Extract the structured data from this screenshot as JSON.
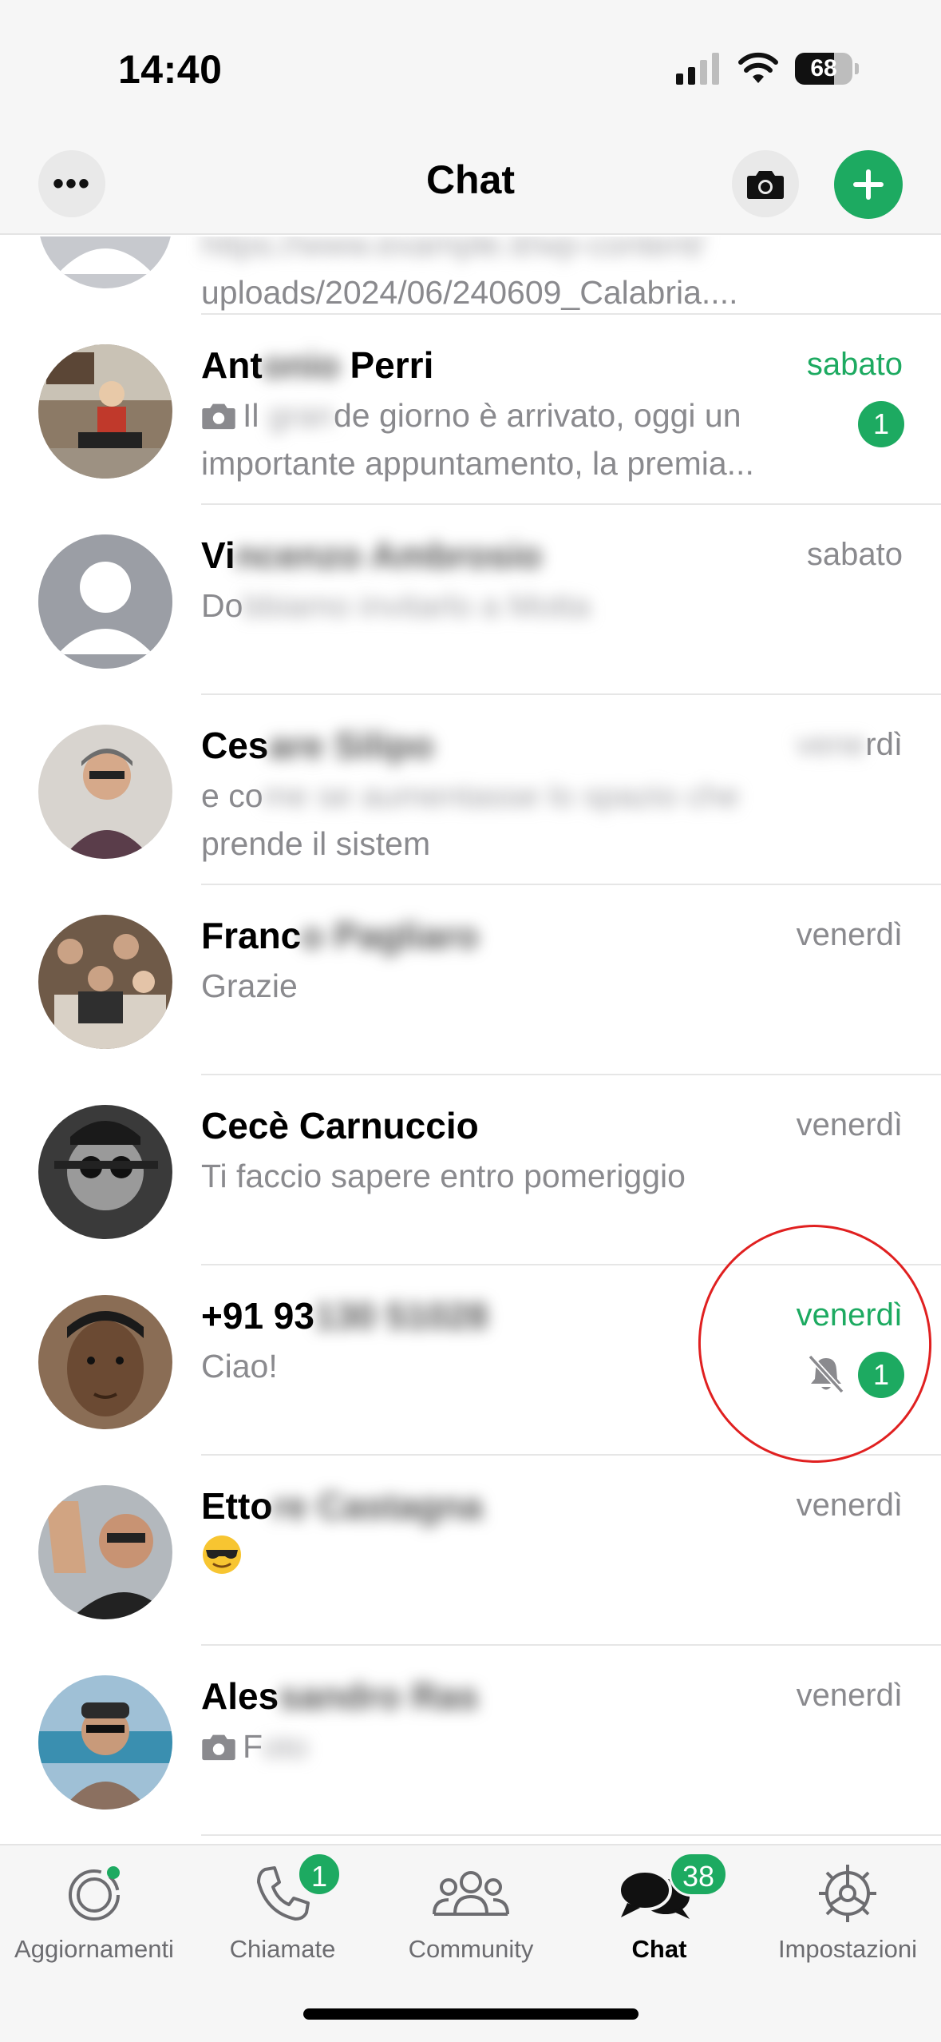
{
  "status_bar": {
    "time": "14:40",
    "battery": "68",
    "battery_level_pct": 68
  },
  "header": {
    "more_label": "•••",
    "title": "Chat"
  },
  "colors": {
    "accent": "#1daa61",
    "secondary_text": "#8a8a8e",
    "annotation": "#e02020"
  },
  "chats": [
    {
      "name": "",
      "date": "",
      "preview": "uploads/2024/06/240609_Calabria....",
      "preview_top": "",
      "avatar": "default"
    },
    {
      "name_visible": "Ant",
      "name_hidden": "onio",
      "name_end": " Perri",
      "date": "sabato",
      "date_green": true,
      "preview_icon": "camera-icon",
      "preview_visible": "Il ",
      "preview_hidden": "gran",
      "preview": "de giorno è arrivato, oggi un importante appuntamento, la premia...",
      "unread": "1",
      "avatar": "photo"
    },
    {
      "name_visible": "Vi",
      "name_hidden": "ncenzo Ambrosio",
      "date": "sabato",
      "preview_visible": "Do",
      "preview_hidden": "bbiamo invitarlo a Motta",
      "avatar": "default"
    },
    {
      "name_visible": "Ces",
      "name_hidden": "are Silipo",
      "date_hidden": "vene",
      "date": "rdì",
      "preview_visible": "e co",
      "preview_hidden": "me se aumentasse lo spazio che",
      "preview": "prende il sistem",
      "avatar": "photo"
    },
    {
      "name_visible": "Franc",
      "name_hidden": "o Pagliaro",
      "date": "venerdì",
      "preview_visible": "Grazie",
      "preview_hidden": "",
      "avatar": "photo"
    },
    {
      "name": "Cecè Carnuccio",
      "date": "venerdì",
      "preview": "Ti faccio sapere entro pomeriggio",
      "avatar": "photo"
    },
    {
      "name_visible": "+91 93",
      "name_hidden": "130 51028",
      "date": "venerdì",
      "date_green": true,
      "preview": "Ciao!",
      "muted": true,
      "unread": "1",
      "avatar": "photo"
    },
    {
      "name_visible": "Etto",
      "name_hidden": "re Castagna",
      "date": "venerdì",
      "preview_icon": "sunglasses-emoji-icon",
      "avatar": "photo"
    },
    {
      "name_visible": "Ales",
      "name_hidden": "sandro Ras",
      "date": "venerdì",
      "preview_icon": "camera-icon",
      "preview_visible": "F",
      "preview_hidden": "oto",
      "avatar": "photo"
    }
  ],
  "tabs": [
    {
      "label": "Aggiornamenti",
      "icon": "updates-icon"
    },
    {
      "label": "Chiamate",
      "icon": "phone-icon",
      "badge": "1"
    },
    {
      "label": "Community",
      "icon": "community-icon"
    },
    {
      "label": "Chat",
      "icon": "chat-bubbles-icon",
      "badge": "38",
      "active": true
    },
    {
      "label": "Impostazioni",
      "icon": "settings-gear-icon"
    }
  ]
}
